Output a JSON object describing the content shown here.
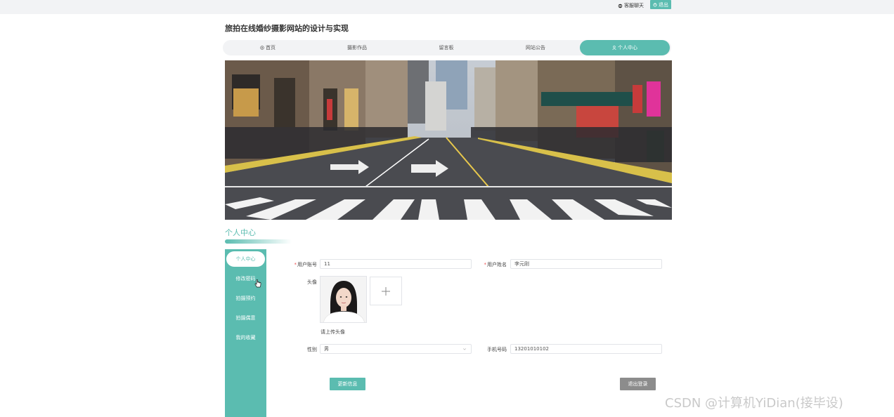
{
  "topbar": {
    "chat_label": "客服聊天",
    "logout_label": "退出"
  },
  "site": {
    "title": "旅拍在线婚纱摄影网站的设计与实现"
  },
  "nav": {
    "items": [
      "首页",
      "摄影作品",
      "留言板",
      "网站公告",
      "个人中心"
    ],
    "active_index": 4
  },
  "section": {
    "title": "个人中心"
  },
  "sidebar": {
    "items": [
      "个人中心",
      "修改密码",
      "拍摄预约",
      "拍摄偶意",
      "我的收藏"
    ],
    "active_index": 0
  },
  "form": {
    "account_label": "用户账号",
    "account_value": "11",
    "name_label": "用户姓名",
    "name_value": "李元刚",
    "avatar_label": "头像",
    "upload_hint": "请上传头像",
    "gender_label": "性别",
    "gender_value": "男",
    "phone_label": "手机号码",
    "phone_value": "13201010102"
  },
  "actions": {
    "update_label": "更新信息",
    "logout_label": "退出登录"
  },
  "watermark": "CSDN @计算机YiDian(接毕设)",
  "colors": {
    "accent": "#5bbcb0",
    "grey_button": "#8c8c8c"
  }
}
